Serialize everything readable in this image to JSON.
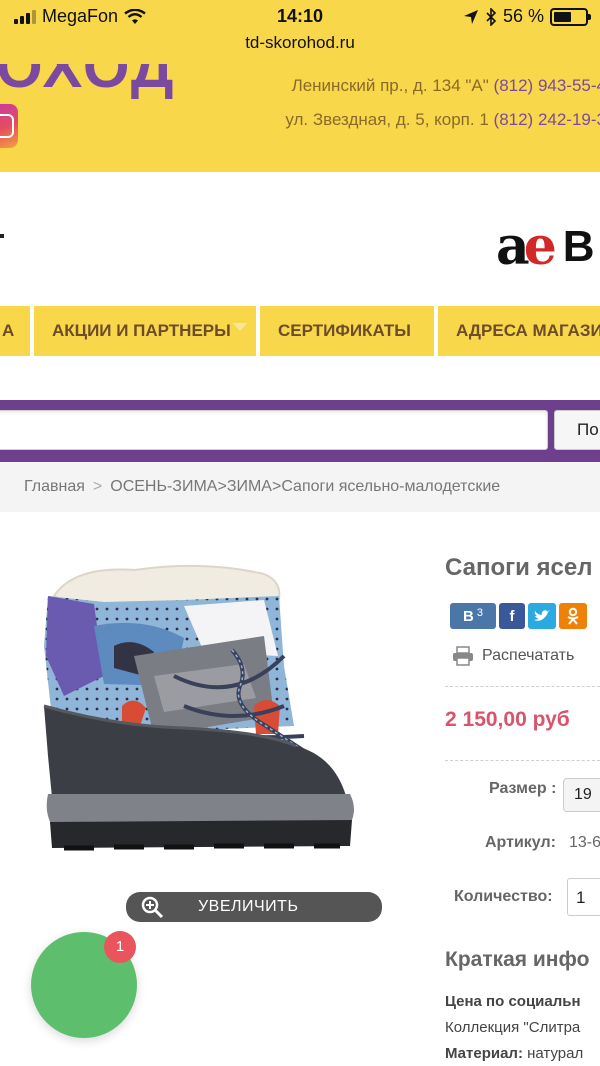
{
  "status_bar": {
    "carrier": "MegaFon",
    "time": "14:10",
    "battery": "56 %",
    "battery_level": 0.56,
    "url": "td-skorohod.ru"
  },
  "header": {
    "logo_fragment": "ОХОД",
    "address_1_text": "Ленинский пр., д. 134 \"А\"",
    "address_1_phone": "(812) 943-55-4",
    "address_2_text": "ул. Звездная, д. 5, корп. 1",
    "address_2_phone": "(812) 242-19-3"
  },
  "brand": {
    "letters_ae_a": "a",
    "letters_ae_e": "e",
    "letter_b": "B"
  },
  "nav": {
    "items": [
      {
        "label": "А"
      },
      {
        "label": "АКЦИИ И ПАРТНЕРЫ"
      },
      {
        "label": "СЕРТИФИКАТЫ"
      },
      {
        "label": "АДРЕСА МАГАЗИ"
      }
    ]
  },
  "search": {
    "placeholder": "",
    "button_label": "По"
  },
  "breadcrumb": {
    "home": "Главная",
    "sep": ">",
    "path": "ОСЕНЬ-ЗИМА>ЗИМА>Сапоги ясельно-малодетские"
  },
  "product": {
    "title": "Сапоги ясел",
    "share": {
      "vk": "В",
      "vk_count": "3",
      "fb": "f",
      "tw": "t",
      "ok": "ok"
    },
    "print_label": "Распечатать",
    "price": "2 150,00 руб",
    "size_label": "Размер :",
    "size_value": "19",
    "article_label": "Артикул:",
    "article_value": "13-6",
    "quantity_label": "Количество:",
    "quantity_value": "1",
    "zoom_label": "УВЕЛИЧИТЬ",
    "short_info_title": "Краткая инфо",
    "info_line_1": "Цена по социальн",
    "info_line_2": "Коллекция \"Слитра",
    "info_line_3_label": "Материал:",
    "info_line_3_value": "натурал"
  },
  "chat": {
    "badge": "1"
  },
  "colors": {
    "header_yellow": "#f8d74a",
    "brand_purple": "#6e3f8c",
    "price_red": "#d9546a",
    "chat_green": "#5dbf6e"
  }
}
